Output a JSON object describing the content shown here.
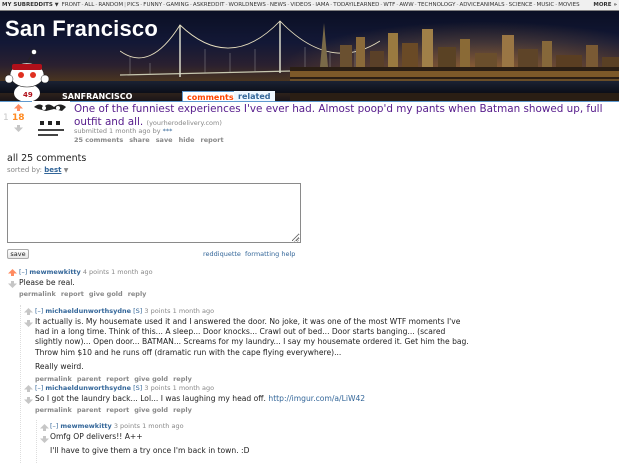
{
  "topbar": {
    "my_subreddits": "MY SUBREDDITS",
    "items": [
      "FRONT",
      "ALL",
      "RANDOM",
      "PICS",
      "FUNNY",
      "GAMING",
      "ASKREDDIT",
      "WORLDNEWS",
      "NEWS",
      "VIDEOS",
      "IAMA",
      "TODAYILEARNED",
      "WTF",
      "AWW",
      "TECHNOLOGY",
      "ADVICEANIMALS",
      "SCIENCE",
      "MUSIC",
      "MOVIES"
    ],
    "more": "MORE »"
  },
  "header": {
    "subreddit_title": "San Francisco",
    "subreddit_name": "SANFRANCISCO",
    "tabs": [
      {
        "label": "comments",
        "active": true
      },
      {
        "label": "related",
        "active": false
      }
    ]
  },
  "link": {
    "rank": "1",
    "score": "18",
    "title": "One of the funniest experiences I've ever had. Almost poop'd my pants when Batman showed up, full outfit and all.",
    "domain": "(yourherodelivery.com)",
    "submitted": "submitted 1 month ago by",
    "author": "***",
    "buttons": [
      "25 comments",
      "share",
      "save",
      "hide",
      "report"
    ]
  },
  "comments_area": {
    "heading": "all 25 comments",
    "sorted_by_label": "sorted by:",
    "sorted_by_value": "best",
    "save_label": "save",
    "reddiquette": "reddiquette",
    "formatting_help": "formatting help"
  },
  "comments": [
    {
      "toggle": "[–]",
      "author": "mewmewkitty",
      "flair": "",
      "meta": "4 points 1 month ago",
      "body": [
        "Please be real."
      ],
      "links": [
        "permalink",
        "report",
        "give gold",
        "reply"
      ]
    },
    {
      "toggle": "[–]",
      "author": "michaeldunworthsydne",
      "flair": "[S]",
      "meta": "3 points 1 month ago",
      "body": [
        "It actually is. My housemate used it and I answered the door. No joke, it was one of the most WTF moments I've had in a long time. Think of this... A sleep... Door knocks... Crawl out of bed... Door starts banging... (scared slightly now)... Open door... BATMAN... Screams for my laundry... I say my housemate ordered it. Get him the bag. Throw him $10 and he runs off (dramatic run with the cape flying everywhere)...",
        "Really weird."
      ],
      "links": [
        "permalink",
        "parent",
        "report",
        "give gold",
        "reply"
      ]
    },
    {
      "toggle": "[–]",
      "author": "michaeldunworthsydne",
      "flair": "[S]",
      "meta": "3 points 1 month ago",
      "body": [
        "So I got the laundry back... Lol... I was laughing my head off."
      ],
      "url": "http://imgur.com/a/LiW42",
      "links": [
        "permalink",
        "parent",
        "report",
        "give gold",
        "reply"
      ]
    },
    {
      "toggle": "[–]",
      "author": "mewmewkitty",
      "flair": "",
      "meta": "3 points 1 month ago",
      "body": [
        "Omfg OP delivers!! A++",
        "I'll have to give them a try once I'm back in town. :D"
      ],
      "links": []
    }
  ],
  "colors": {
    "upvote": "#ff8b60",
    "score": "#ff8b24",
    "link": "#551a8b",
    "author": "#336699",
    "meta": "#888888"
  }
}
